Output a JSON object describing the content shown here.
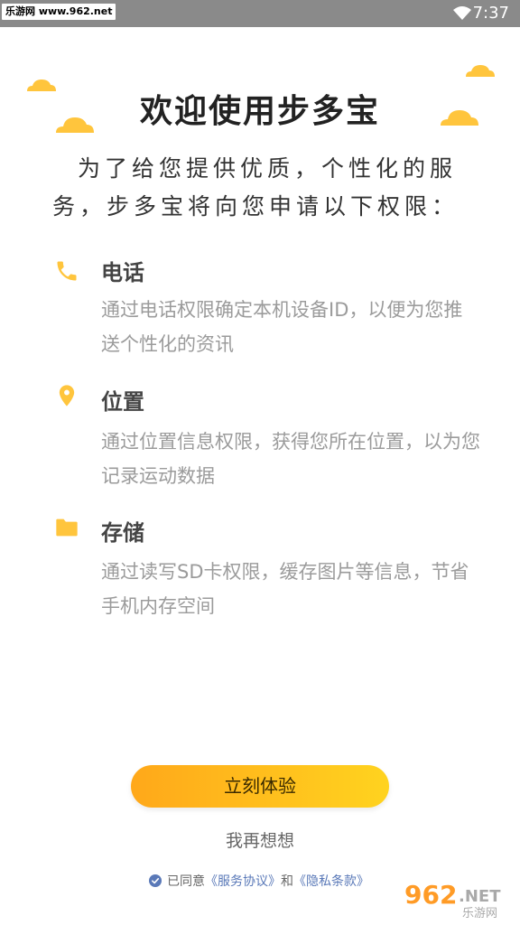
{
  "status": {
    "watermark": "乐游网 www.962.net",
    "time": "7:37"
  },
  "header": {
    "title": "欢迎使用步多宝",
    "intro": "为了给您提供优质，个性化的服务，步多宝将向您申请以下权限："
  },
  "permissions": [
    {
      "icon": "phone-icon",
      "title": "电话",
      "desc": "通过电话权限确定本机设备ID，以便为您推送个性化的资讯"
    },
    {
      "icon": "location-pin-icon",
      "title": "位置",
      "desc": "通过位置信息权限，获得您所在位置，以为您记录运动数据"
    },
    {
      "icon": "folder-icon",
      "title": "存储",
      "desc": "通过读写SD卡权限，缓存图片等信息，节省手机内存空间"
    }
  ],
  "actions": {
    "primary": "立刻体验",
    "secondary": "我再想想"
  },
  "agreement": {
    "prefix": "已同意",
    "service": "《服务协议》",
    "and": "和",
    "privacy": "《隐私条款》"
  },
  "brand_watermark": {
    "number": "962",
    "net": ".NET",
    "site": "乐游网"
  },
  "colors": {
    "accent": "#ffc53d",
    "button_start": "#ffa81a",
    "button_end": "#ffd31f",
    "link": "#5a79b8"
  }
}
